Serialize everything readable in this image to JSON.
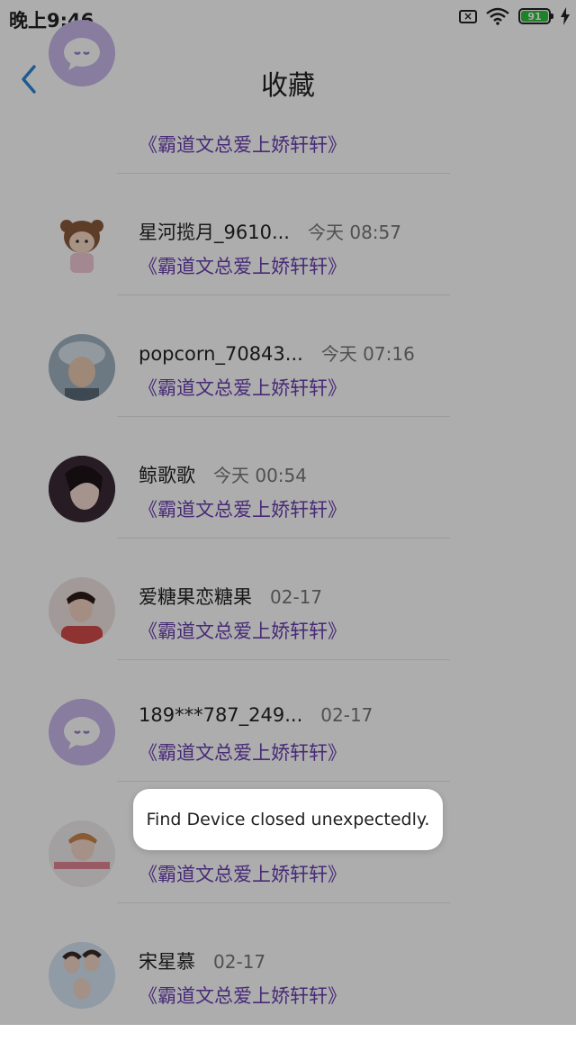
{
  "status_bar": {
    "time": "晚上9:46",
    "battery_level": "91",
    "icons": [
      "sim-off-icon",
      "wifi-icon",
      "battery-icon",
      "charging-icon"
    ]
  },
  "header": {
    "title": "收藏",
    "back_icon": "chevron-left-icon"
  },
  "colors": {
    "accent": "#6b3fb0",
    "overlay": "rgba(0,0,0,0.32)",
    "back": "#2e84d8"
  },
  "items": [
    {
      "name": "",
      "time": "",
      "book": "《霸道文总爱上娇轩轩》"
    },
    {
      "name": "星河揽月_9610...",
      "time": "今天 08:57",
      "book": "《霸道文总爱上娇轩轩》"
    },
    {
      "name": "popcorn_70843...",
      "time": "今天 07:16",
      "book": "《霸道文总爱上娇轩轩》"
    },
    {
      "name": "鲸歌歌",
      "time": "今天 00:54",
      "book": "《霸道文总爱上娇轩轩》"
    },
    {
      "name": "爱糖果恋糖果",
      "time": "02-17",
      "book": "《霸道文总爱上娇轩轩》"
    },
    {
      "name": "189***787_249...",
      "time": "02-17",
      "book": "《霸道文总爱上娇轩轩》"
    },
    {
      "name": "",
      "time": "",
      "book": "《霸道文总爱上娇轩轩》"
    },
    {
      "name": "宋星慕",
      "time": "02-17",
      "book": "《霸道文总爱上娇轩轩》"
    }
  ],
  "toast": {
    "message": "Find Device closed unexpectedly."
  }
}
